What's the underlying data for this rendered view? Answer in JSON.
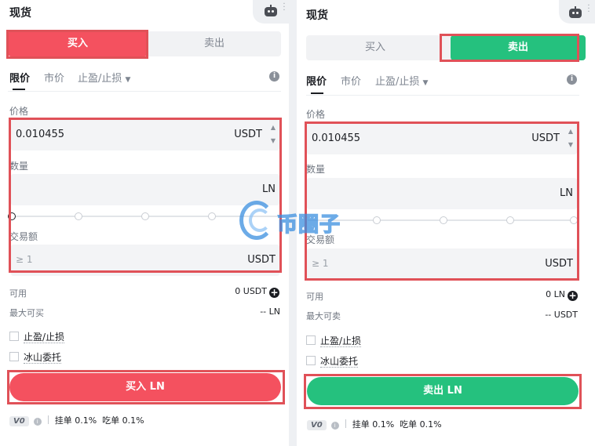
{
  "left": {
    "title": "现货",
    "buy_tab": "买入",
    "sell_tab": "卖出",
    "order_tabs": [
      "限价",
      "市价",
      "止盈/止损"
    ],
    "price_label": "价格",
    "price_value": "0.010455",
    "price_unit": "USDT",
    "qty_label": "数量",
    "qty_unit": "LN",
    "amount_label": "交易额",
    "amount_placeholder": "≥ 1",
    "amount_unit": "USDT",
    "available_label": "可用",
    "available_value": "0 USDT",
    "max_label": "最大可买",
    "max_value": "-- LN",
    "tpsl_label": "止盈/止损",
    "iceberg_label": "冰山委托",
    "action_button": "买入 LN",
    "vip_badge": "V0",
    "maker_fee": "挂单 0.1%",
    "taker_fee": "吃单 0.1%"
  },
  "right": {
    "title": "现货",
    "buy_tab": "买入",
    "sell_tab": "卖出",
    "order_tabs": [
      "限价",
      "市价",
      "止盈/止损"
    ],
    "price_label": "价格",
    "price_value": "0.010455",
    "price_unit": "USDT",
    "qty_label": "数量",
    "qty_unit": "LN",
    "amount_label": "交易额",
    "amount_placeholder": "≥ 1",
    "amount_unit": "USDT",
    "available_label": "可用",
    "available_value": "0 LN",
    "max_label": "最大可卖",
    "max_value": "-- USDT",
    "tpsl_label": "止盈/止损",
    "iceberg_label": "冰山委托",
    "action_button": "卖出 LN",
    "vip_badge": "V0",
    "maker_fee": "挂单 0.1%",
    "taker_fee": "吃单 0.1%"
  },
  "watermark": "币圈子",
  "colors": {
    "buy": "#f4515f",
    "sell": "#25c17e",
    "highlight": "#e05158"
  }
}
